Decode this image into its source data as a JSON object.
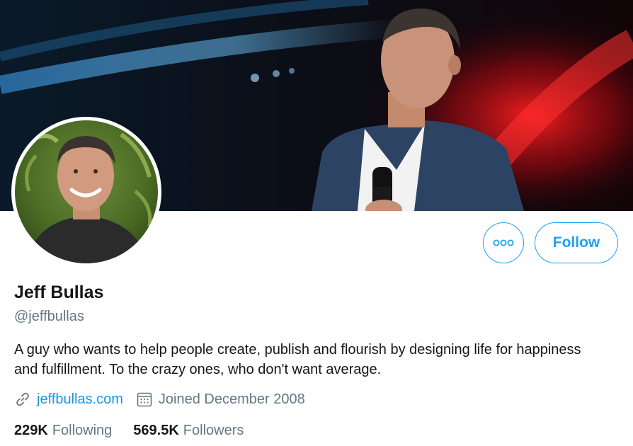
{
  "profile": {
    "name": "Jeff Bullas",
    "handle": "@jeffbullas",
    "bio": "A guy who wants to help people create, publish and flourish by designing life for happiness and fulfillment. To the crazy ones, who don't want average.",
    "website": "jeffbullas.com",
    "joined": "Joined December 2008"
  },
  "actions": {
    "follow_label": "Follow",
    "more_icon": "more-options-icon"
  },
  "stats": {
    "following_count": "229K",
    "following_label": "Following",
    "followers_count": "569.5K",
    "followers_label": "Followers"
  },
  "icons": {
    "website": "link-icon",
    "joined": "calendar-icon"
  },
  "colors": {
    "accent": "#1da1f2",
    "link": "#1b95e0",
    "secondary_text": "#657786",
    "primary_text": "#14171a",
    "banner_red": "#d0101a"
  }
}
